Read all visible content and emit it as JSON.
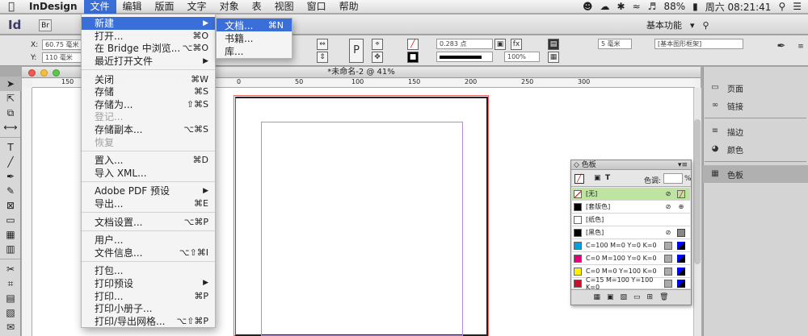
{
  "menubar": {
    "app_name": "InDesign",
    "menus": [
      "文件",
      "编辑",
      "版面",
      "文字",
      "对象",
      "表",
      "视图",
      "窗口",
      "帮助"
    ],
    "active_menu": "文件",
    "battery": "88%",
    "datetime": "周六 08:21:41"
  },
  "appbar": {
    "logo": "Id",
    "bridge": "Br",
    "workspace": "基本功能"
  },
  "controlbar": {
    "x_label": "X:",
    "x_value": "60.75 毫米",
    "y_label": "Y:",
    "y_value": "110 毫米",
    "stroke_weight": "0.283 点",
    "opacity": "100%",
    "measure": "5 毫米",
    "frame_style": "[基本图形框架]"
  },
  "document": {
    "title": "*未命名-2 @ 41%",
    "ruler_marks": [
      "150",
      "100",
      "50",
      "0",
      "50",
      "100",
      "150",
      "200",
      "250",
      "300"
    ]
  },
  "file_menu": {
    "items": [
      {
        "label": "新建",
        "shortcut": "",
        "arrow": true,
        "highlight": true
      },
      {
        "label": "打开...",
        "shortcut": "⌘O"
      },
      {
        "label": "在 Bridge 中浏览...",
        "shortcut": "⌥⌘O"
      },
      {
        "label": "最近打开文件",
        "shortcut": "",
        "arrow": true
      },
      {
        "sep": true
      },
      {
        "label": "关闭",
        "shortcut": "⌘W"
      },
      {
        "label": "存储",
        "shortcut": "⌘S"
      },
      {
        "label": "存储为...",
        "shortcut": "⇧⌘S"
      },
      {
        "label": "登记...",
        "shortcut": "",
        "disabled": true
      },
      {
        "label": "存储副本...",
        "shortcut": "⌥⌘S"
      },
      {
        "label": "恢复",
        "shortcut": "",
        "disabled": true
      },
      {
        "sep": true
      },
      {
        "label": "置入...",
        "shortcut": "⌘D"
      },
      {
        "label": "导入 XML...",
        "shortcut": ""
      },
      {
        "sep": true
      },
      {
        "label": "Adobe PDF 预设",
        "shortcut": "",
        "arrow": true
      },
      {
        "label": "导出...",
        "shortcut": "⌘E"
      },
      {
        "sep": true
      },
      {
        "label": "文档设置...",
        "shortcut": "⌥⌘P"
      },
      {
        "sep": true
      },
      {
        "label": "用户...",
        "shortcut": ""
      },
      {
        "label": "文件信息...",
        "shortcut": "⌥⇧⌘I"
      },
      {
        "sep": true
      },
      {
        "label": "打包...",
        "shortcut": ""
      },
      {
        "label": "打印预设",
        "shortcut": "",
        "arrow": true
      },
      {
        "label": "打印...",
        "shortcut": "⌘P"
      },
      {
        "label": "打印小册子...",
        "shortcut": ""
      },
      {
        "label": "打印/导出网格...",
        "shortcut": "⌥⇧⌘P"
      }
    ]
  },
  "new_submenu": {
    "items": [
      {
        "label": "文档...",
        "shortcut": "⌘N",
        "highlight": true
      },
      {
        "label": "书籍...",
        "shortcut": ""
      },
      {
        "label": "库...",
        "shortcut": ""
      }
    ]
  },
  "right_dock": {
    "items": [
      {
        "label": "页面",
        "icon": "pages-icon",
        "glyph": "▭"
      },
      {
        "label": "链接",
        "icon": "links-icon",
        "glyph": "∞"
      },
      {
        "label": "描边",
        "icon": "stroke-icon",
        "glyph": "≡"
      },
      {
        "label": "颜色",
        "icon": "color-icon",
        "glyph": "◕"
      },
      {
        "label": "色板",
        "icon": "swatches-icon",
        "glyph": "▦"
      }
    ]
  },
  "swatches_panel": {
    "title": "色板",
    "tint_label": "色调:",
    "tint_unit": "%",
    "rows": [
      {
        "name": "[无]",
        "color": "none",
        "selected": true
      },
      {
        "name": "[套版色]",
        "color": "#000000"
      },
      {
        "name": "[纸色]",
        "color": "#ffffff"
      },
      {
        "name": "[黑色]",
        "color": "#000000"
      },
      {
        "name": "C=100 M=0 Y=0 K=0",
        "color": "#00a0e0"
      },
      {
        "name": "C=0 M=100 Y=0 K=0",
        "color": "#e2007a"
      },
      {
        "name": "C=0 M=0 Y=100 K=0",
        "color": "#fff000"
      },
      {
        "name": "C=15 M=100 Y=100 K=0",
        "color": "#c8102e"
      }
    ]
  }
}
